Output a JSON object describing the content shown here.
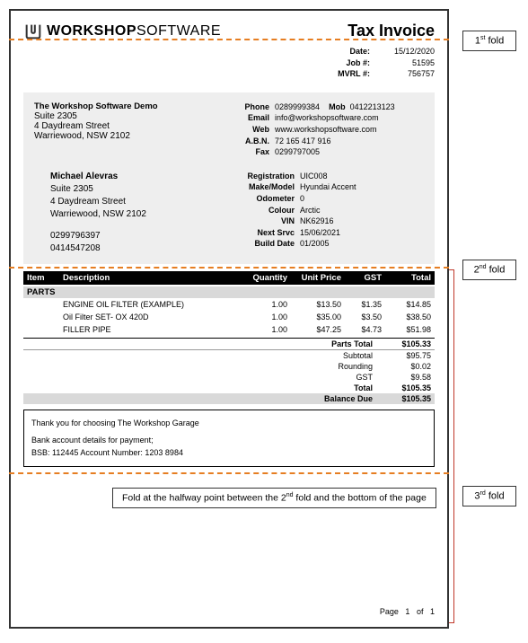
{
  "logo_text_bold": "WORKSHOP",
  "logo_text_light": "SOFTWARE",
  "tax_invoice_title": "Tax Invoice",
  "meta": {
    "date_label": "Date:",
    "date_val": "15/12/2020",
    "job_label": "Job #:",
    "job_val": "51595",
    "mvrl_label": "MVRL #:",
    "mvrl_val": "756757"
  },
  "company": {
    "name": "The Workshop Software Demo",
    "line1": "Suite 2305",
    "line2": "4 Daydream Street",
    "line3": "Warriewood, NSW 2102"
  },
  "contact": {
    "phone_lbl": "Phone",
    "phone_val": "0289999384",
    "mob_lbl": "Mob",
    "mob_val": "0412213123",
    "email_lbl": "Email",
    "email_val": "info@workshopsoftware.com",
    "web_lbl": "Web",
    "web_val": "www.workshopsoftware.com",
    "abn_lbl": "A.B.N.",
    "abn_val": "72 165 417 916",
    "fax_lbl": "Fax",
    "fax_val": "0299797005"
  },
  "customer": {
    "name": "Michael Alevras",
    "line1": "Suite 2305",
    "line2": "4 Daydream Street",
    "line3": "Warriewood, NSW 2102",
    "phone1": "0299796397",
    "phone2": "0414547208"
  },
  "vehicle": {
    "reg_lbl": "Registration",
    "reg_val": "UIC008",
    "mm_lbl": "Make/Model",
    "mm_val": "Hyundai Accent",
    "odo_lbl": "Odometer",
    "odo_val": "0",
    "col_lbl": "Colour",
    "col_val": "Arctic",
    "vin_lbl": "VIN",
    "vin_val": "NK62916",
    "ns_lbl": "Next Srvc",
    "ns_val": "15/06/2021",
    "bd_lbl": "Build Date",
    "bd_val": "01/2005"
  },
  "table_headers": {
    "item": "Item",
    "desc": "Description",
    "qty": "Quantity",
    "unit": "Unit Price",
    "gst": "GST",
    "total": "Total"
  },
  "parts_label": "PARTS",
  "lines": [
    {
      "desc": "ENGINE OIL FILTER (EXAMPLE)",
      "qty": "1.00",
      "unit": "$13.50",
      "gst": "$1.35",
      "total": "$14.85"
    },
    {
      "desc": "Oil Filter SET- OX 420D",
      "qty": "1.00",
      "unit": "$35.00",
      "gst": "$3.50",
      "total": "$38.50"
    },
    {
      "desc": "FILLER PIPE",
      "qty": "1.00",
      "unit": "$47.25",
      "gst": "$4.73",
      "total": "$51.98"
    }
  ],
  "totals": {
    "parts_total_lbl": "Parts Total",
    "parts_total_val": "$105.33",
    "sub_lbl": "Subtotal",
    "sub_val": "$95.75",
    "round_lbl": "Rounding",
    "round_val": "$0.02",
    "gst_lbl": "GST",
    "gst_val": "$9.58",
    "total_lbl": "Total",
    "total_val": "$105.35",
    "bal_lbl": "Balance Due",
    "bal_val": "$105.35"
  },
  "payment": {
    "thanks": "Thank you for choosing The Workshop Garage",
    "details_lbl": "Bank account details for payment;",
    "bsb": "BSB: 112445   Account Number: 1203 8984"
  },
  "footer": {
    "page_lbl": "Page",
    "page_cur": "1",
    "page_of": "of",
    "page_total": "1"
  },
  "annotations": {
    "fold1": "1",
    "fold1_suf": "st",
    "fold1_txt": " fold",
    "fold2": "2",
    "fold2_suf": "nd",
    "fold2_txt": " fold",
    "fold3": "3",
    "fold3_suf": "rd",
    "fold3_txt": " fold",
    "halfway": "Fold at the halfway point between the 2",
    "halfway_suf": "nd",
    "halfway_rest": " fold and the bottom of the page"
  }
}
